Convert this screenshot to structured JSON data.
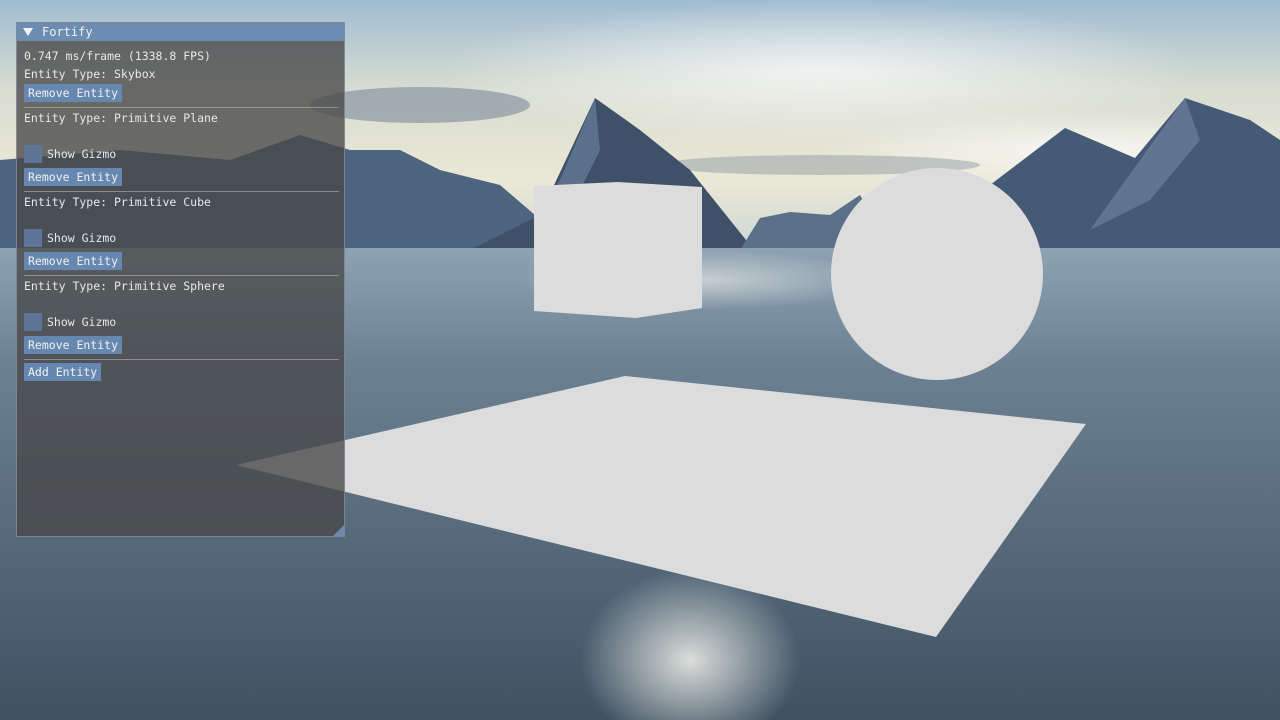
{
  "scene": {
    "colors": {
      "sky_top": "#a9c3d6",
      "sky_mid": "#dfe2d6",
      "sky_horizon": "#e9e6d4",
      "mountain": "#3f5470",
      "mountain_light": "#5a7290",
      "water_near": "#4f6272",
      "water_far": "#7f96a8",
      "primitive": "#dcdcdc"
    },
    "objects": [
      "skybox-background",
      "primitive-plane",
      "primitive-cube",
      "primitive-sphere"
    ]
  },
  "panel": {
    "title": "Fortify",
    "title_icon": "collapse-triangle-icon",
    "fps_text": "0.747 ms/frame (1338.8 FPS)",
    "entities": [
      {
        "type_label": "Entity Type: Skybox",
        "has_gizmo": false,
        "remove_label": "Remove Entity"
      },
      {
        "type_label": "Entity Type: Primitive Plane",
        "has_gizmo": true,
        "gizmo_label": "Show Gizmo",
        "gizmo_checked": false,
        "remove_label": "Remove Entity"
      },
      {
        "type_label": "Entity Type: Primitive Cube",
        "has_gizmo": true,
        "gizmo_label": "Show Gizmo",
        "gizmo_checked": false,
        "remove_label": "Remove Entity"
      },
      {
        "type_label": "Entity Type: Primitive Sphere",
        "has_gizmo": true,
        "gizmo_label": "Show Gizmo",
        "gizmo_checked": false,
        "remove_label": "Remove Entity"
      }
    ],
    "add_label": "Add Entity",
    "colors": {
      "titlebar": "#6d8cb2",
      "button": "#6587b0",
      "checkbox": "#5f7597",
      "text": "#e8e8e8"
    }
  }
}
